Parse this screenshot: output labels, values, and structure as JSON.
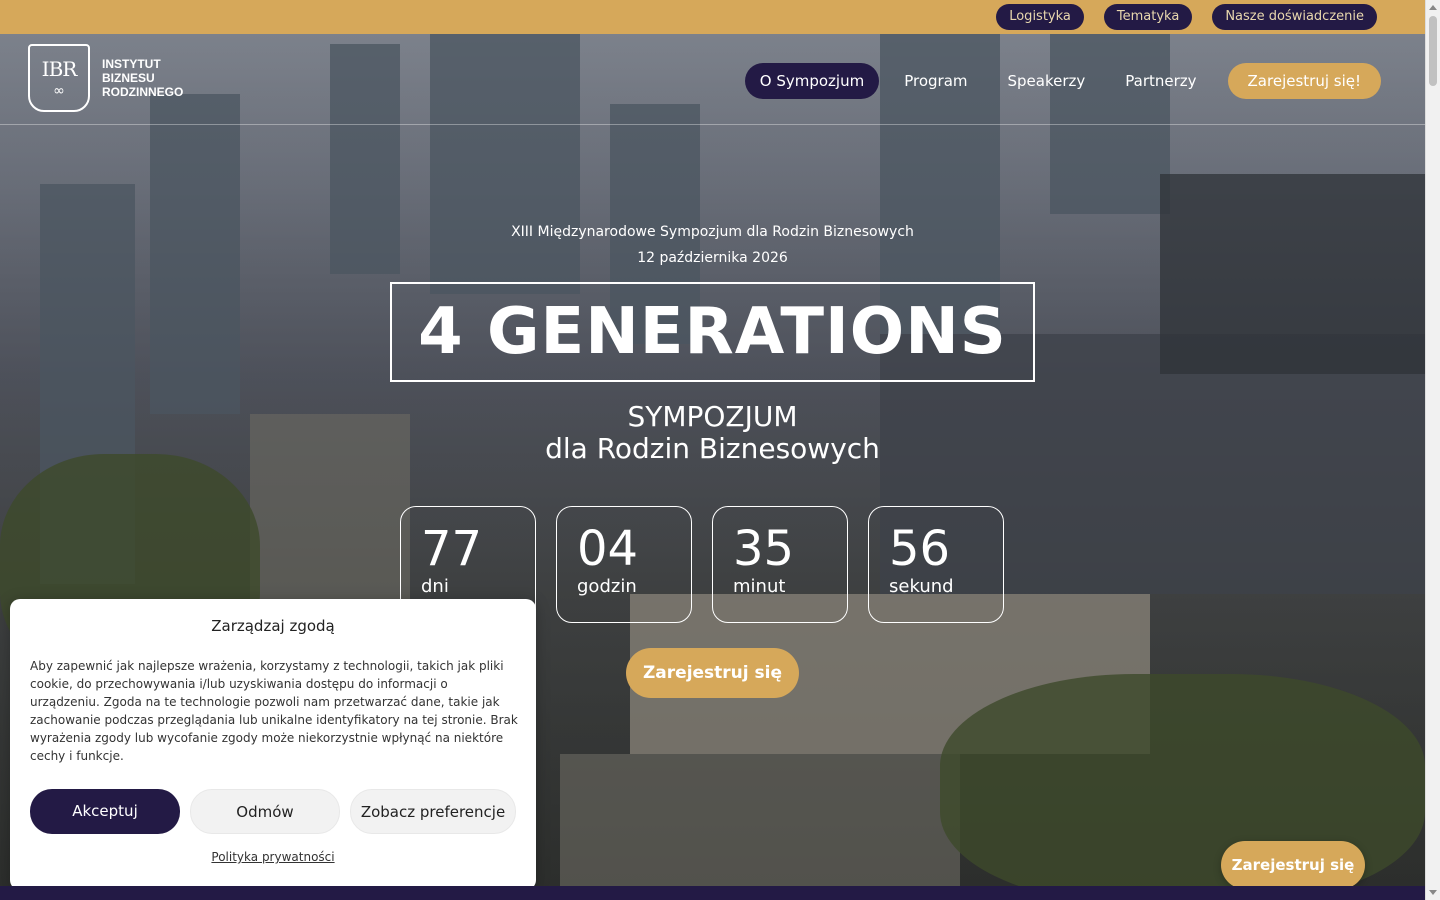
{
  "topbar": {
    "links": [
      "Logistyka",
      "Tematyka",
      "Nasze doświadczenie"
    ]
  },
  "logo": {
    "monogram": "IBR",
    "line1": "INSTYTUT",
    "line2": "BIZNESU",
    "line3": "RODZINNEGO"
  },
  "nav": {
    "items": [
      "O Sympozjum",
      "Program",
      "Speakerzy",
      "Partnerzy"
    ],
    "active_index": 0,
    "cta": "Zarejestruj się!"
  },
  "hero": {
    "subtitle": "XIII Międzynarodowe Sympozjum dla Rodzin Biznesowych",
    "date": "12 października 2026",
    "title": "4 GENERATIONS",
    "line1": "SYMPOZJUM",
    "line2": "dla Rodzin Biznesowych",
    "cta": "Zarejestruj się"
  },
  "countdown": [
    {
      "value": "77",
      "label": "dni"
    },
    {
      "value": "04",
      "label": "godzin"
    },
    {
      "value": "35",
      "label": "minut"
    },
    {
      "value": "56",
      "label": "sekund"
    }
  ],
  "consent": {
    "title": "Zarządzaj zgodą",
    "text": "Aby zapewnić jak najlepsze wrażenia, korzystamy z technologii, takich jak pliki cookie, do przechowywania i/lub uzyskiwania dostępu do informacji o urządzeniu. Zgoda na te technologie pozwoli nam przetwarzać dane, takie jak zachowanie podczas przeglądania lub unikalne identyfikatory na tej stronie. Brak wyrażenia zgody lub wycofanie zgody może niekorzystnie wpłynąć na niektóre cechy i funkcje.",
    "accept": "Akceptuj",
    "deny": "Odmów",
    "preferences": "Zobacz preferencje",
    "privacy_link": "Polityka prywatności"
  },
  "floating_cta": "Zarejestruj się",
  "colors": {
    "gold": "#d6a85a",
    "navy": "#231a45"
  }
}
